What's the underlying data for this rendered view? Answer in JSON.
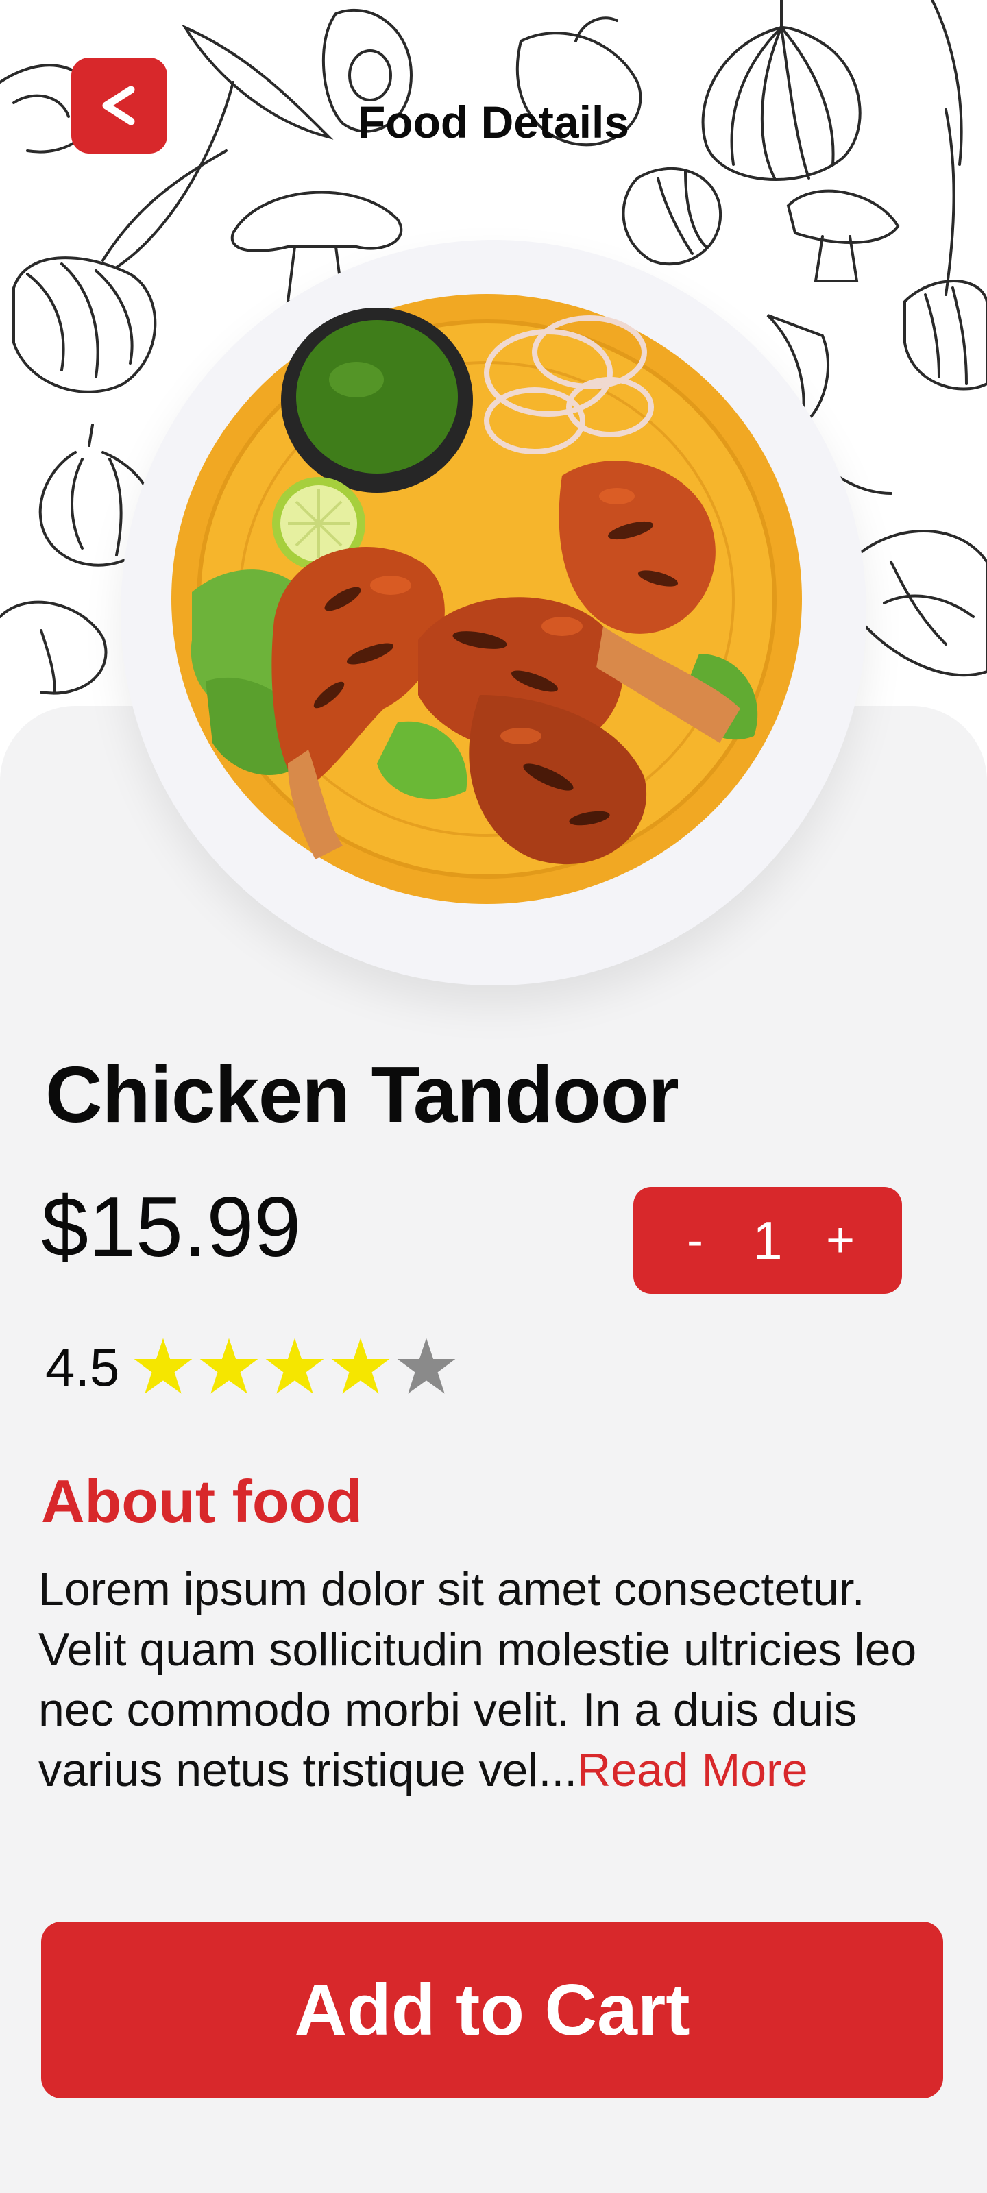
{
  "header": {
    "back_icon": "chevron-left-icon",
    "title": "Food Details"
  },
  "food": {
    "name": "Chicken Tandoor",
    "price": "$15.99",
    "image_icon": "tandoori-chicken-plate",
    "quantity": {
      "decrement_label": "-",
      "value": "1",
      "increment_label": "+"
    },
    "rating": {
      "value_text": "4.5",
      "value": 4,
      "max": 5
    }
  },
  "about": {
    "heading": "About food",
    "body": "Lorem ipsum dolor sit amet consectetur. Velit quam sollicitudin molestie ultricies leo nec commodo morbi velit. In a duis duis varius netus tristique vel...",
    "read_more": "Read More"
  },
  "cart": {
    "label": "Add to Cart"
  },
  "colors": {
    "accent": "#d8282b",
    "background": "#f3f3f4",
    "star_filled": "#f5e600",
    "star_empty": "#8a8a8a"
  }
}
